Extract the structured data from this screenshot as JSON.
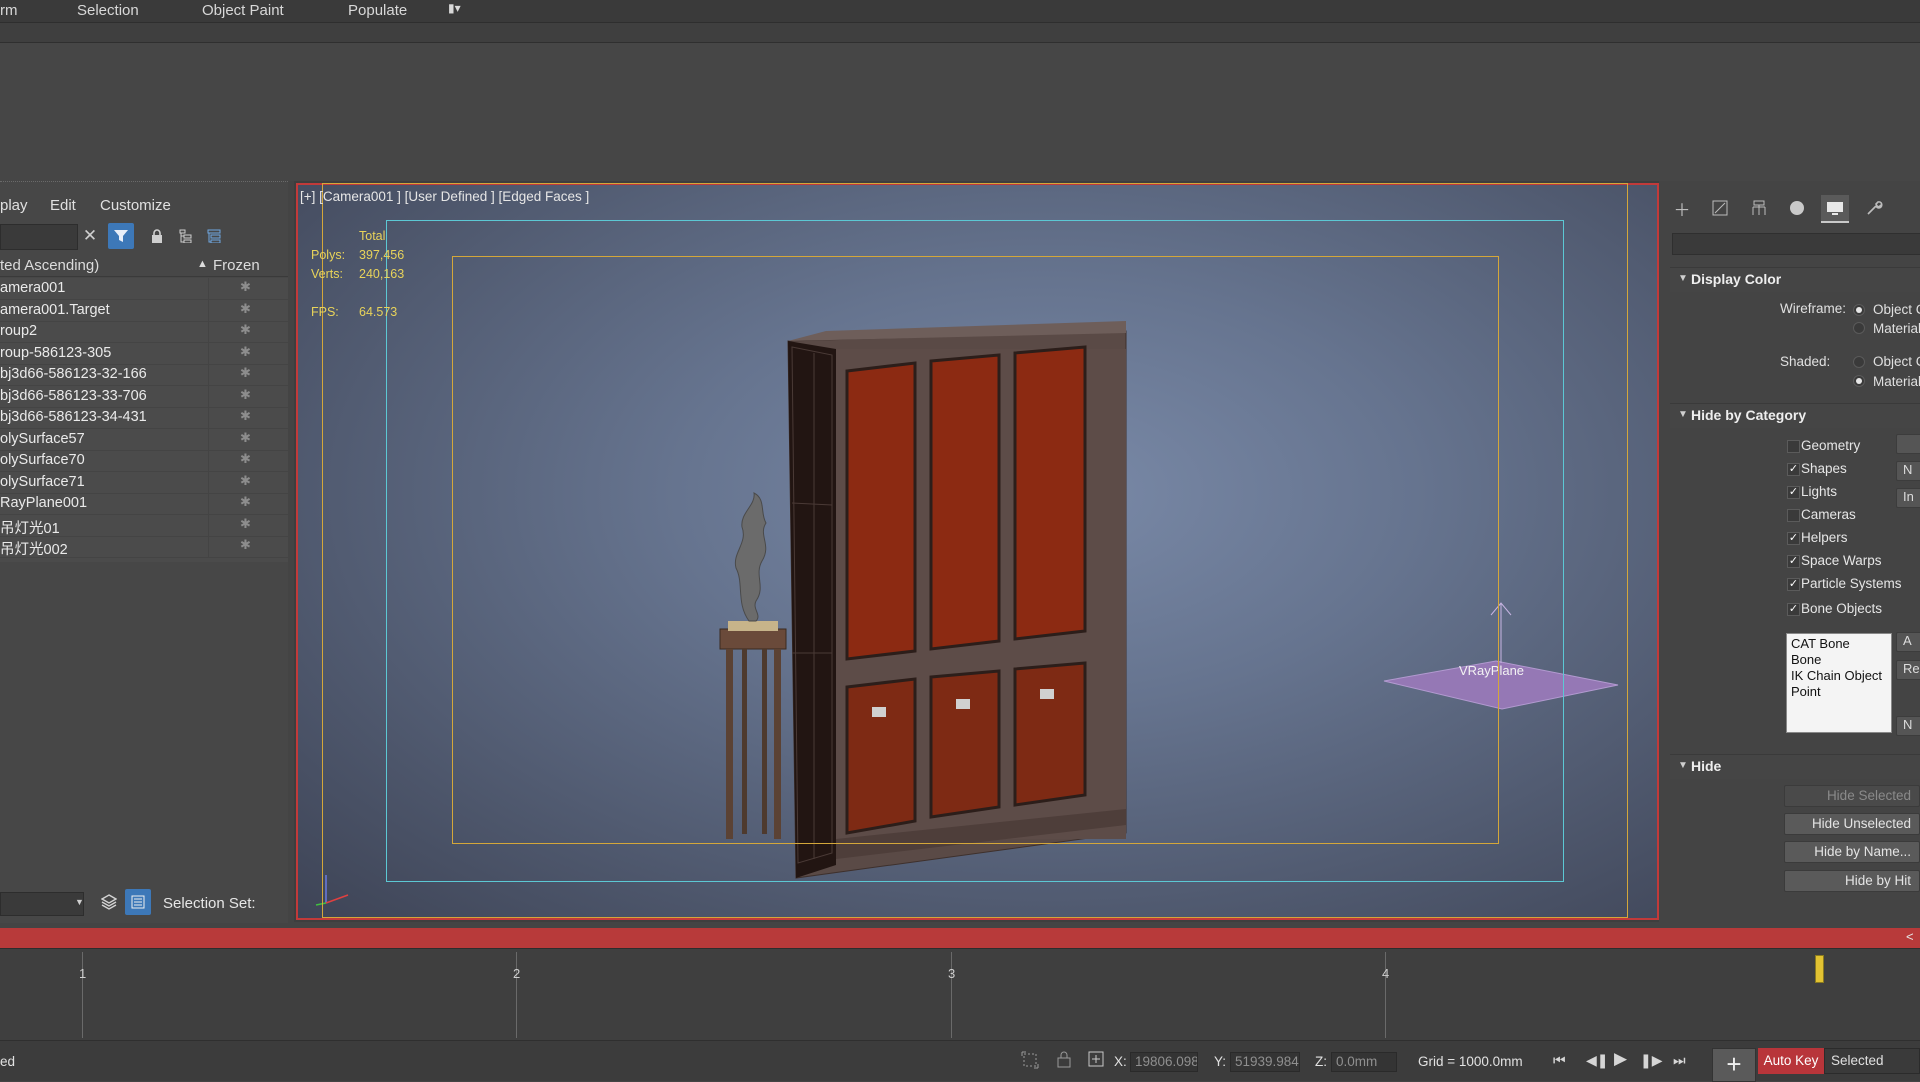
{
  "menubar": {
    "items": [
      "rm",
      "Selection",
      "Object Paint",
      "Populate"
    ]
  },
  "explorer": {
    "menus": [
      "play",
      "Edit",
      "Customize"
    ],
    "sort_header": "ted Ascending)",
    "frozen_header": "Frozen",
    "rows": [
      "amera001",
      "amera001.Target",
      "roup2",
      "roup-586123-305",
      "bj3d66-586123-32-166",
      "bj3d66-586123-33-706",
      "bj3d66-586123-34-431",
      "olySurface57",
      "olySurface70",
      "olySurface71",
      "RayPlane001",
      "吊灯光01",
      "吊灯光002"
    ],
    "selection_set_label": "Selection Set:"
  },
  "viewport": {
    "label": "[+] [Camera001 ] [User Defined ] [Edged Faces ]",
    "stats": {
      "total_label": "Total",
      "polys_label": "Polys:",
      "polys_value": "397,456",
      "verts_label": "Verts:",
      "verts_value": "240,163",
      "fps_label": "FPS:",
      "fps_value": "64.573"
    },
    "object_label": "VRayPlane"
  },
  "cmdpanel": {
    "display_color": {
      "title": "Display Color",
      "wireframe_label": "Wireframe:",
      "shaded_label": "Shaded:",
      "opt_object": "Object C",
      "opt_material": "Material"
    },
    "hide_by_category": {
      "title": "Hide by Category",
      "items": [
        {
          "label": "Geometry",
          "checked": false
        },
        {
          "label": "Shapes",
          "checked": true
        },
        {
          "label": "Lights",
          "checked": true
        },
        {
          "label": "Cameras",
          "checked": false
        },
        {
          "label": "Helpers",
          "checked": true
        },
        {
          "label": "Space Warps",
          "checked": true
        },
        {
          "label": "Particle Systems",
          "checked": true
        },
        {
          "label": "Bone Objects",
          "checked": true
        }
      ],
      "side_buttons": [
        "N",
        "In",
        "A",
        "Re",
        "N"
      ],
      "list": [
        "CAT Bone",
        "Bone",
        "IK Chain Object",
        "Point"
      ]
    },
    "hide": {
      "title": "Hide",
      "buttons": [
        "Hide Selected",
        "Hide Unselected",
        "Hide by Name...",
        "Hide by Hit"
      ]
    }
  },
  "timeline": {
    "ticks": [
      "1",
      "2",
      "3",
      "4"
    ]
  },
  "statusbar": {
    "left_text": "ed",
    "x_label": "X:",
    "x_value": "19806.098",
    "y_label": "Y:",
    "y_value": "51939.984",
    "z_label": "Z:",
    "z_value": "0.0mm",
    "grid": "Grid = 1000.0mm",
    "autokey": "Auto Key",
    "key_filter": "Selected"
  },
  "colors": {
    "accent_red": "#c23a3a",
    "time_bar": "#b83a3a",
    "safe_frame_yellow": "#d4a73a",
    "safe_frame_cyan": "#5cc8d4",
    "stats_yellow": "#e8d35a",
    "active_button_blue": "#3d78b8"
  }
}
